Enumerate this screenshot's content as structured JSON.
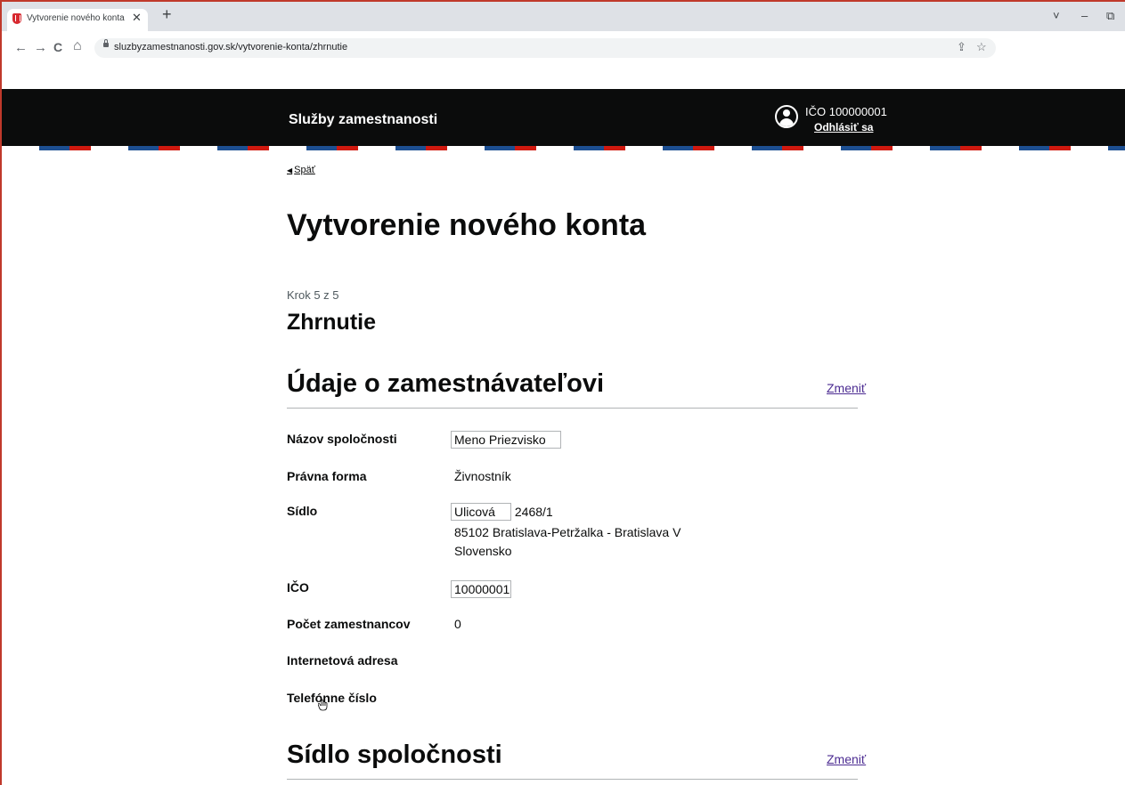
{
  "browser": {
    "tab_title": "Vytvorenie nového konta - Služb",
    "tab_close": "✕",
    "new_tab": "+",
    "url": "sluzbyzamestnanosti.gov.sk/vytvorenie-konta/zhrnutie",
    "nav": {
      "back": "←",
      "forward": "→",
      "reload": "C",
      "home": "⌂"
    },
    "window_controls": {
      "tab_search": "˅",
      "minimize": "–",
      "restore": "⧉"
    },
    "omnibox_icons": {
      "share": "⇪",
      "bookmark": "☆"
    }
  },
  "header": {
    "site_title": "Služby zamestnanosti",
    "user_ico": "IČO 100000001",
    "logout": "Odhlásiť sa"
  },
  "page": {
    "back": "Späť",
    "title": "Vytvorenie nového konta",
    "step": "Krok 5 z 5",
    "step_title": "Zhrnutie"
  },
  "section_employer": {
    "title": "Údaje o zamestnávateľovi",
    "change": "Zmeniť",
    "rows": {
      "name_label": "Názov spoločnosti",
      "name_value": "Meno Priezvisko",
      "legal_label": "Právna forma",
      "legal_value": "Živnostník",
      "seat_label": "Sídlo",
      "street": "Ulicová",
      "number": "2468/1",
      "city_line": "85102 Bratislava-Petržalka - Bratislava V",
      "country": "Slovensko",
      "ico_label": "IČO",
      "ico_value": "10000001",
      "employees_label": "Počet zamestnancov",
      "employees_value": "0",
      "web_label": "Internetová adresa",
      "phone_label": "Telefónne číslo"
    }
  },
  "section_seat": {
    "title": "Sídlo spoločnosti",
    "change": "Zmeniť"
  }
}
